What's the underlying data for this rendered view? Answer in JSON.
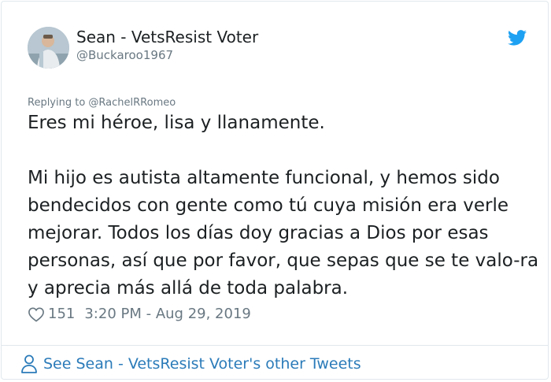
{
  "tweet": {
    "author_name": "Sean - VetsResist Voter",
    "author_handle": "@Buckaroo1967",
    "replying_to": "Replying to @RachelRRomeo",
    "paragraphs": [
      "Eres mi héroe, lisa y llanamente.",
      "Mi hijo es autista altamente funcional, y hemos sido bendecidos con gente como tú cuya misión era verle mejorar. Todos los días doy gracias a Dios por esas personas, así que por favor, que sepas que se te valo-ra y aprecia más allá de toda palabra."
    ],
    "likes": "151",
    "timestamp": "3:20 PM - Aug 29, 2019"
  },
  "footer": {
    "link_label": "See Sean - VetsResist Voter's other Tweets"
  },
  "icons": {
    "brand": "twitter-bird-icon",
    "like": "heart-icon",
    "profile": "person-icon"
  },
  "colors": {
    "brand_blue": "#1da1f2",
    "link_blue": "#2b7bb9",
    "muted_gray": "#697882",
    "text_dark": "#1c2022",
    "border": "#e1e8ed"
  }
}
